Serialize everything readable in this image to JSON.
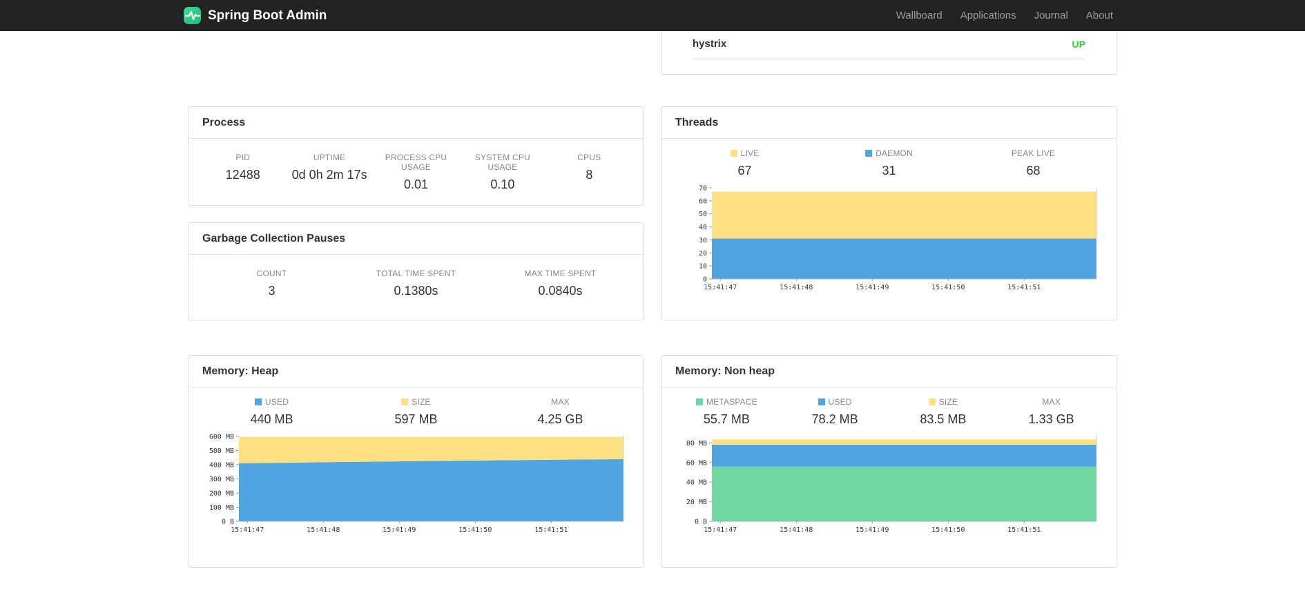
{
  "navbar": {
    "brand": "Spring Boot Admin",
    "links": [
      {
        "label": "Wallboard"
      },
      {
        "label": "Applications"
      },
      {
        "label": "Journal"
      },
      {
        "label": "About"
      }
    ]
  },
  "status_card": {
    "rows": [
      {
        "name": "hystrix",
        "status": "UP"
      }
    ]
  },
  "cards": {
    "process": {
      "title": "Process",
      "metrics": [
        {
          "label": "PID",
          "value": "12488"
        },
        {
          "label": "UPTIME",
          "value": "0d 0h 2m 17s"
        },
        {
          "label": "PROCESS CPU USAGE",
          "value": "0.01"
        },
        {
          "label": "SYSTEM CPU USAGE",
          "value": "0.10"
        },
        {
          "label": "CPUS",
          "value": "8"
        }
      ]
    },
    "gc": {
      "title": "Garbage Collection Pauses",
      "metrics": [
        {
          "label": "COUNT",
          "value": "3"
        },
        {
          "label": "TOTAL TIME SPENT",
          "value": "0.1380s"
        },
        {
          "label": "MAX TIME SPENT",
          "value": "0.0840s"
        }
      ]
    },
    "threads": {
      "title": "Threads",
      "legend": [
        {
          "label": "LIVE",
          "value": "67",
          "color": "#FFE082"
        },
        {
          "label": "DAEMON",
          "value": "31",
          "color": "#4EA5E0"
        },
        {
          "label": "PEAK LIVE",
          "value": "68"
        }
      ]
    },
    "heap": {
      "title": "Memory: Heap",
      "legend": [
        {
          "label": "USED",
          "value": "440 MB",
          "color": "#4EA5E0"
        },
        {
          "label": "SIZE",
          "value": "597 MB",
          "color": "#FFE082"
        },
        {
          "label": "MAX",
          "value": "4.25 GB"
        }
      ]
    },
    "nonheap": {
      "title": "Memory: Non heap",
      "legend": [
        {
          "label": "METASPACE",
          "value": "55.7 MB",
          "color": "#6FD7A3"
        },
        {
          "label": "USED",
          "value": "78.2 MB",
          "color": "#4EA5E0"
        },
        {
          "label": "SIZE",
          "value": "83.5 MB",
          "color": "#FFE082"
        },
        {
          "label": "MAX",
          "value": "1.33 GB"
        }
      ]
    }
  },
  "colors": {
    "accent_blue": "#4EA5E0",
    "accent_yellow": "#FFE082",
    "accent_green": "#6FD7A3",
    "status_up_green": "#32CD32",
    "brand_logo_green": "#2FCE98",
    "navbar_bg": "#222222"
  },
  "chart_data": [
    {
      "id": "threads-chart",
      "type": "area",
      "stacked": true,
      "x": [
        "15:41:47",
        "15:41:48",
        "15:41:49",
        "15:41:50",
        "15:41:51"
      ],
      "ymax": 70,
      "y_ticks": [
        {
          "v": 0,
          "label": "0"
        },
        {
          "v": 10,
          "label": "10"
        },
        {
          "v": 20,
          "label": "20"
        },
        {
          "v": 30,
          "label": "30"
        },
        {
          "v": 40,
          "label": "40"
        },
        {
          "v": 50,
          "label": "50"
        },
        {
          "v": 60,
          "label": "60"
        },
        {
          "v": 70,
          "label": "70"
        }
      ],
      "series": [
        {
          "name": "DAEMON",
          "color": "#4EA5E0",
          "values": [
            31,
            31,
            31,
            31,
            31
          ]
        },
        {
          "name": "LIVE",
          "color": "#FFE082",
          "values": [
            67,
            67,
            67,
            67,
            67
          ]
        }
      ],
      "legend_position": "top",
      "grid": false
    },
    {
      "id": "heap-memory-chart",
      "type": "area",
      "stacked": true,
      "x": [
        "15:41:47",
        "15:41:48",
        "15:41:49",
        "15:41:50",
        "15:41:51"
      ],
      "ymax": 610,
      "y_ticks": [
        {
          "v": 0,
          "label": "0 B"
        },
        {
          "v": 100,
          "label": "100 MB"
        },
        {
          "v": 200,
          "label": "200 MB"
        },
        {
          "v": 300,
          "label": "300 MB"
        },
        {
          "v": 400,
          "label": "400 MB"
        },
        {
          "v": 500,
          "label": "500 MB"
        },
        {
          "v": 600,
          "label": "600 MB"
        }
      ],
      "series": [
        {
          "name": "USED",
          "color": "#4EA5E0",
          "values": [
            410,
            419,
            427,
            434,
            440
          ]
        },
        {
          "name": "SIZE",
          "color": "#FFE082",
          "values": [
            597,
            597,
            597,
            597,
            597
          ]
        }
      ],
      "legend_position": "top",
      "grid": false
    },
    {
      "id": "nonheap-memory-chart",
      "type": "area",
      "stacked": true,
      "x": [
        "15:41:47",
        "15:41:48",
        "15:41:49",
        "15:41:50",
        "15:41:51"
      ],
      "ymax": 88,
      "y_ticks": [
        {
          "v": 0,
          "label": "0 B"
        },
        {
          "v": 20,
          "label": "20 MB"
        },
        {
          "v": 40,
          "label": "40 MB"
        },
        {
          "v": 60,
          "label": "60 MB"
        },
        {
          "v": 80,
          "label": "80 MB"
        }
      ],
      "series": [
        {
          "name": "METASPACE",
          "color": "#6FD7A3",
          "values": [
            55.7,
            55.7,
            55.7,
            55.7,
            55.7
          ]
        },
        {
          "name": "USED",
          "color": "#4EA5E0",
          "values": [
            78.2,
            78.2,
            78.2,
            78.2,
            78.2
          ]
        },
        {
          "name": "SIZE",
          "color": "#FFE082",
          "values": [
            83.5,
            83.5,
            83.5,
            83.5,
            83.5
          ]
        }
      ],
      "legend_position": "top",
      "grid": false
    }
  ]
}
